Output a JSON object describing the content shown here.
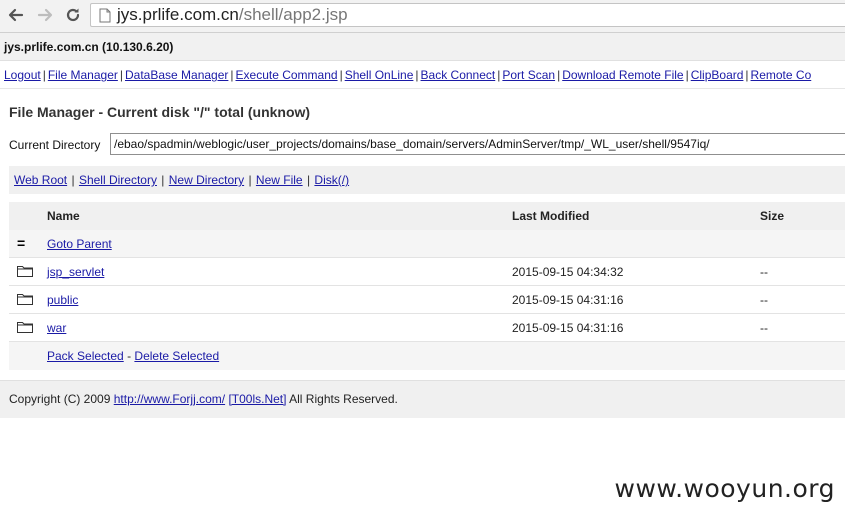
{
  "browser": {
    "url_host": "jys.prlife.com.cn",
    "url_path": "/shell/app2.jsp"
  },
  "host_line": "jys.prlife.com.cn (10.130.6.20)",
  "menu": [
    "Logout",
    "File Manager",
    "DataBase Manager",
    "Execute Command",
    "Shell OnLine",
    "Back Connect",
    "Port Scan",
    "Download Remote File",
    "ClipBoard",
    "Remote Co"
  ],
  "title": "File Manager - Current disk \"/\" total (unknow)",
  "current_directory": {
    "label": "Current Directory",
    "value": "/ebao/spadmin/weblogic/user_projects/domains/base_domain/servers/AdminServer/tmp/_WL_user/shell/9547iq/"
  },
  "actions": [
    "Web Root",
    "Shell Directory",
    "New Directory",
    "New File",
    "Disk(/)"
  ],
  "table": {
    "headers": {
      "name": "Name",
      "modified": "Last Modified",
      "size": "Size"
    },
    "parent_label": "Goto Parent",
    "rows": [
      {
        "name": "jsp_servlet",
        "modified": "2015-09-15 04:34:32",
        "size": "--"
      },
      {
        "name": "public",
        "modified": "2015-09-15 04:31:16",
        "size": "--"
      },
      {
        "name": "war",
        "modified": "2015-09-15 04:31:16",
        "size": "--"
      }
    ],
    "pack_selected": "Pack Selected",
    "delete_selected": "Delete Selected"
  },
  "copyright": {
    "prefix": "Copyright (C) 2009",
    "link1": "http://www.Forjj.com/",
    "link2": "[T00ls.Net]",
    "suffix": "All Rights Reserved."
  },
  "watermark": "www.wooyun.org"
}
